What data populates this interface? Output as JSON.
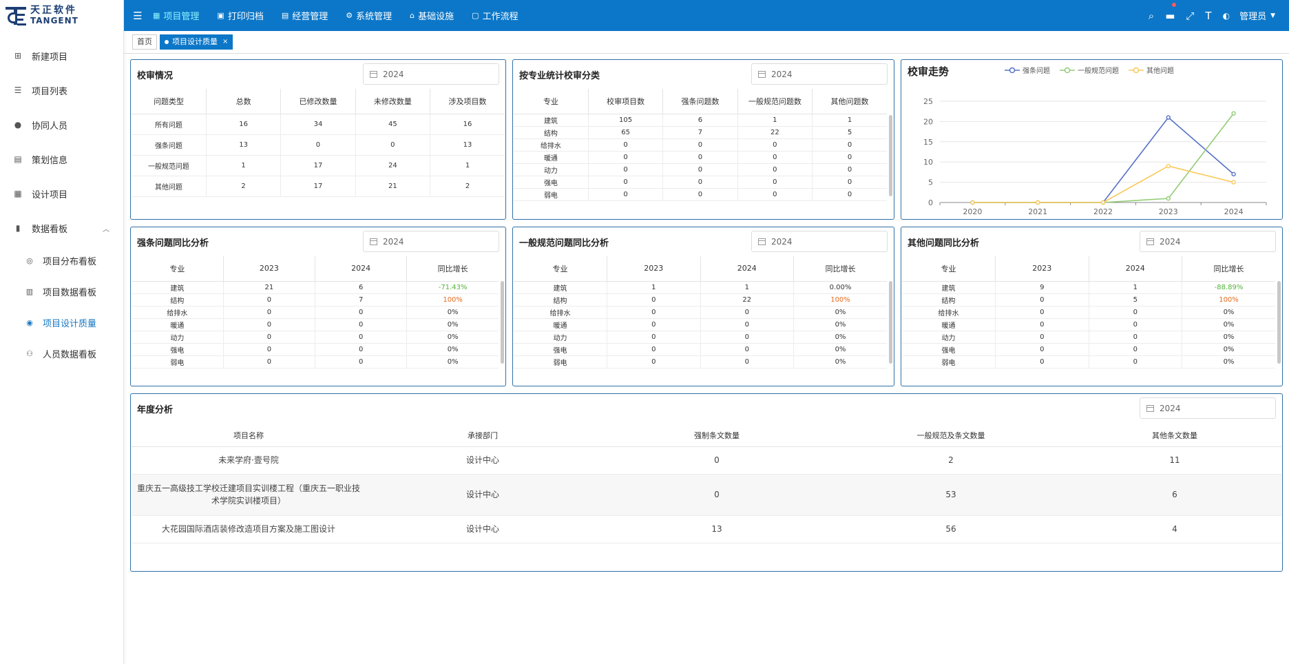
{
  "logo": {
    "cn": "天正软件",
    "en": "TANGENT"
  },
  "sidebar": {
    "items": [
      {
        "label": "新建项目",
        "icon": "doc-plus-icon"
      },
      {
        "label": "项目列表",
        "icon": "list-icon"
      },
      {
        "label": "协同人员",
        "icon": "user-icon"
      },
      {
        "label": "策划信息",
        "icon": "doc-icon"
      },
      {
        "label": "设计项目",
        "icon": "file-icon"
      },
      {
        "label": "数据看板",
        "icon": "chart-icon"
      }
    ],
    "sub_items": [
      {
        "label": "项目分布看板",
        "icon": "location-icon"
      },
      {
        "label": "项目数据看板",
        "icon": "books-icon"
      },
      {
        "label": "项目设计质量",
        "icon": "quality-icon"
      },
      {
        "label": "人员数据看板",
        "icon": "people-icon"
      }
    ]
  },
  "topbar": {
    "menu": [
      {
        "label": "项目管理",
        "icon": "grid-icon"
      },
      {
        "label": "打印归档",
        "icon": "print-icon"
      },
      {
        "label": "经营管理",
        "icon": "ledger-icon"
      },
      {
        "label": "系统管理",
        "icon": "gear-icon"
      },
      {
        "label": "基础设施",
        "icon": "infra-icon"
      },
      {
        "label": "工作流程",
        "icon": "flow-icon"
      }
    ],
    "user": "管理员"
  },
  "tabs": {
    "home": "首页",
    "current": "项目设计质量",
    "close": "×"
  },
  "year": "2024",
  "review": {
    "title": "校审情况",
    "headers": [
      "问题类型",
      "总数",
      "已修改数量",
      "未修改数量",
      "涉及项目数"
    ],
    "rows": [
      [
        "所有问题",
        "16",
        "34",
        "45",
        "16"
      ],
      [
        "强条问题",
        "13",
        "0",
        "0",
        "13"
      ],
      [
        "一般规范问题",
        "1",
        "17",
        "24",
        "1"
      ],
      [
        "其他问题",
        "2",
        "17",
        "21",
        "2"
      ]
    ]
  },
  "by_discipline": {
    "title": "按专业统计校审分类",
    "headers": [
      "专业",
      "校审项目数",
      "强条问题数",
      "一般规范问题数",
      "其他问题数"
    ],
    "rows": [
      [
        "建筑",
        "105",
        "6",
        "1",
        "1"
      ],
      [
        "结构",
        "65",
        "7",
        "22",
        "5"
      ],
      [
        "给排水",
        "0",
        "0",
        "0",
        "0"
      ],
      [
        "暖通",
        "0",
        "0",
        "0",
        "0"
      ],
      [
        "动力",
        "0",
        "0",
        "0",
        "0"
      ],
      [
        "强电",
        "0",
        "0",
        "0",
        "0"
      ],
      [
        "弱电",
        "0",
        "0",
        "0",
        "0"
      ]
    ]
  },
  "trend": {
    "title": "校审走势"
  },
  "chart_data": {
    "type": "line",
    "title": "校审走势",
    "x": [
      "2020",
      "2021",
      "2022",
      "2023",
      "2024"
    ],
    "ylim": [
      0,
      25
    ],
    "yticks": [
      0,
      5,
      10,
      15,
      20,
      25
    ],
    "grid": true,
    "legend_position": "top",
    "series": [
      {
        "name": "强条问题",
        "color": "#5470c6",
        "values": [
          0,
          0,
          0,
          21,
          7
        ]
      },
      {
        "name": "一般规范问题",
        "color": "#91cc75",
        "values": [
          0,
          0,
          0,
          1,
          22
        ]
      },
      {
        "name": "其他问题",
        "color": "#fac858",
        "values": [
          0,
          0,
          0,
          9,
          5
        ]
      }
    ]
  },
  "yoy": [
    {
      "title": "强条问题同比分析",
      "headers": [
        "专业",
        "2023",
        "2024",
        "同比增长"
      ],
      "rows": [
        [
          "建筑",
          "21",
          "6",
          "-71.43%"
        ],
        [
          "结构",
          "0",
          "7",
          "100%"
        ],
        [
          "给排水",
          "0",
          "0",
          "0%"
        ],
        [
          "暖通",
          "0",
          "0",
          "0%"
        ],
        [
          "动力",
          "0",
          "0",
          "0%"
        ],
        [
          "强电",
          "0",
          "0",
          "0%"
        ],
        [
          "弱电",
          "0",
          "0",
          "0%"
        ]
      ]
    },
    {
      "title": "一般规范问题同比分析",
      "headers": [
        "专业",
        "2023",
        "2024",
        "同比增长"
      ],
      "rows": [
        [
          "建筑",
          "1",
          "1",
          "0.00%"
        ],
        [
          "结构",
          "0",
          "22",
          "100%"
        ],
        [
          "给排水",
          "0",
          "0",
          "0%"
        ],
        [
          "暖通",
          "0",
          "0",
          "0%"
        ],
        [
          "动力",
          "0",
          "0",
          "0%"
        ],
        [
          "强电",
          "0",
          "0",
          "0%"
        ],
        [
          "弱电",
          "0",
          "0",
          "0%"
        ]
      ]
    },
    {
      "title": "其他问题同比分析",
      "headers": [
        "专业",
        "2023",
        "2024",
        "同比增长"
      ],
      "rows": [
        [
          "建筑",
          "9",
          "1",
          "-88.89%"
        ],
        [
          "结构",
          "0",
          "5",
          "100%"
        ],
        [
          "给排水",
          "0",
          "0",
          "0%"
        ],
        [
          "暖通",
          "0",
          "0",
          "0%"
        ],
        [
          "动力",
          "0",
          "0",
          "0%"
        ],
        [
          "强电",
          "0",
          "0",
          "0%"
        ],
        [
          "弱电",
          "0",
          "0",
          "0%"
        ]
      ]
    }
  ],
  "annual": {
    "title": "年度分析",
    "headers": [
      "项目名称",
      "承接部门",
      "强制条文数量",
      "一般规范及条文数量",
      "其他条文数量"
    ],
    "rows": [
      [
        "未来学府·壹号院",
        "设计中心",
        "0",
        "2",
        "11"
      ],
      [
        "重庆五一高级技工学校迁建项目实训楼工程（重庆五一职业技术学院实训楼项目）",
        "设计中心",
        "0",
        "53",
        "6"
      ],
      [
        "大花园国际酒店装修改造项目方案及施工图设计",
        "设计中心",
        "13",
        "56",
        "4"
      ]
    ]
  },
  "colors": {
    "primary": "#0c77c8",
    "panel_border": "#2e6fa6",
    "growth_negative": "#52b23a",
    "growth_positive": "#e56a1f"
  }
}
